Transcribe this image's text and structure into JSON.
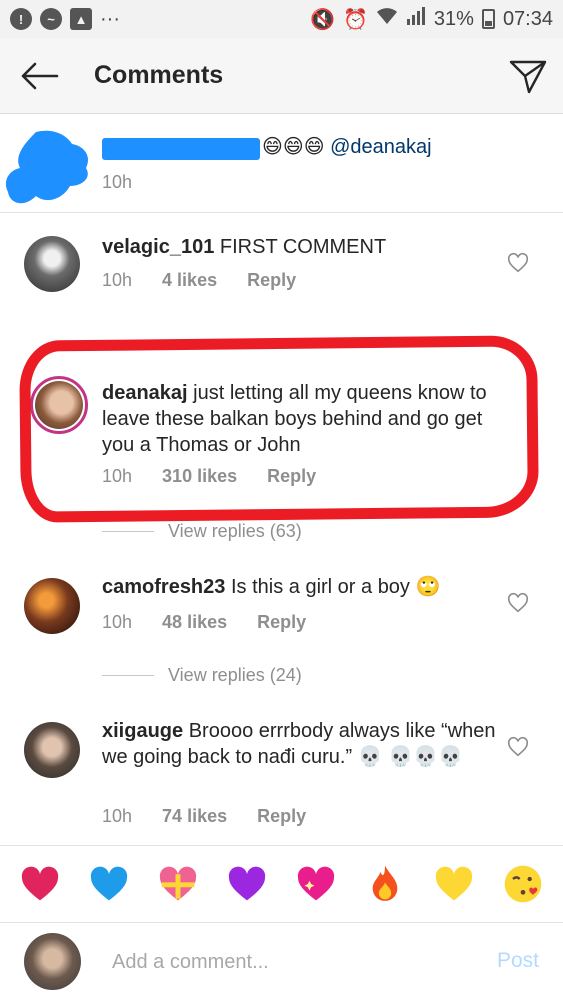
{
  "status_bar": {
    "battery": "31%",
    "time": "07:34",
    "more": "···"
  },
  "header": {
    "title": "Comments"
  },
  "caption": {
    "text_suffix": "@deanakaj",
    "emojis": "😄😄😄",
    "time": "10h"
  },
  "comments": [
    {
      "username": "velagic_101",
      "text": "FIRST COMMENT",
      "time": "10h",
      "likes": "4 likes",
      "reply": "Reply"
    },
    {
      "username": "deanakaj",
      "text": "just letting all my queens know to leave these balkan boys behind and go get you a Thomas or John",
      "time": "10h",
      "likes": "310 likes",
      "reply": "Reply",
      "view_replies": "View replies (63)"
    },
    {
      "username": "camofresh23",
      "text": "Is this a girl or a boy 🙄",
      "time": "10h",
      "likes": "48 likes",
      "reply": "Reply",
      "view_replies": "View replies (24)"
    },
    {
      "username": "xiigauge",
      "text": "Broooo errrbody always like “when we going back to nađi curu.” 💀 💀💀💀",
      "time": "10h",
      "likes": "74 likes",
      "reply": "Reply"
    }
  ],
  "emoji_bar": [
    "red-heart",
    "blue-heart",
    "heart-with-ribbon",
    "purple-heart",
    "sparkling-heart",
    "fire",
    "yellow-heart",
    "face-blowing-kiss"
  ],
  "input": {
    "placeholder": "Add a comment...",
    "post_label": "Post"
  },
  "colors": {
    "annotation_red": "#ec1c24",
    "redaction_blue": "#1e90ff",
    "post_disabled": "#b3dbff"
  }
}
